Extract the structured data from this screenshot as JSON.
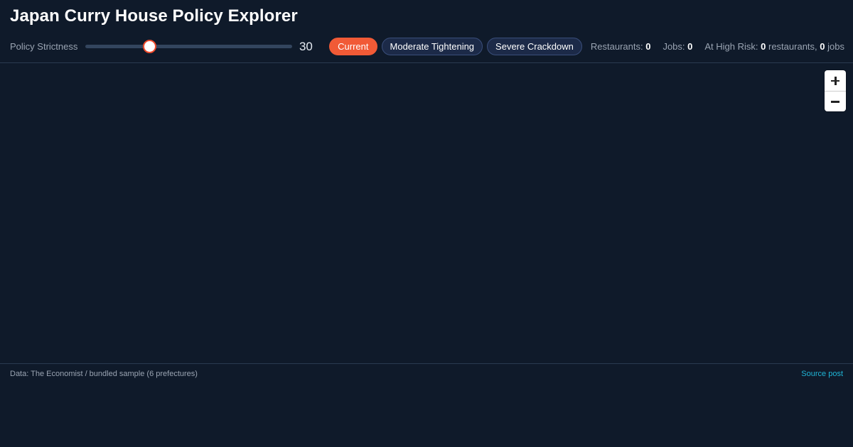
{
  "header": {
    "title": "Japan Curry House Policy Explorer"
  },
  "controls": {
    "slider_label": "Policy Strictness",
    "slider_value": "30",
    "slider_fraction": 0.31,
    "presets": [
      {
        "label": "Current",
        "active": true
      },
      {
        "label": "Moderate Tightening",
        "active": false
      },
      {
        "label": "Severe Crackdown",
        "active": false
      }
    ]
  },
  "stats": {
    "restaurants_label": "Restaurants:",
    "restaurants_value": "0",
    "jobs_label": "Jobs:",
    "jobs_value": "0",
    "high_risk_label": "At High Risk:",
    "high_risk_restaurants_value": "0",
    "high_risk_restaurants_unit": "restaurants,",
    "high_risk_jobs_value": "0",
    "high_risk_jobs_unit": "jobs"
  },
  "map": {
    "zoom_in": "+",
    "zoom_out": "−"
  },
  "footer": {
    "note": "Data: The Economist / bundled sample (6 prefectures)",
    "link": "Source post"
  },
  "colors": {
    "background": "#0f1a2a",
    "accent": "#f15a36",
    "preset_inactive": "#1c2a48",
    "link": "#1fb5d6"
  }
}
